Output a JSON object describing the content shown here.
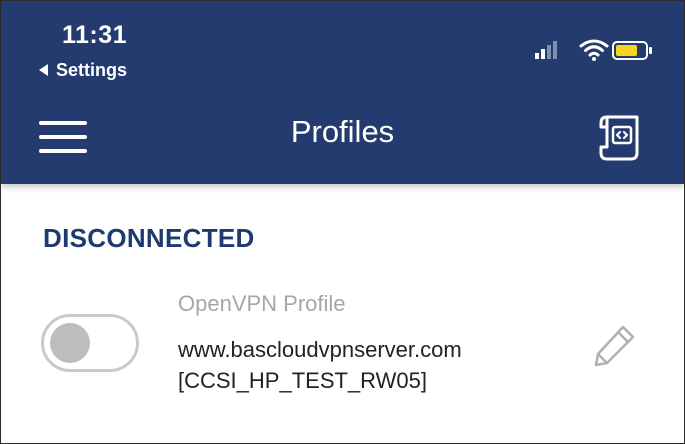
{
  "status_bar": {
    "time": "11:31",
    "back_label": "Settings",
    "battery_color": "#f7d51d"
  },
  "nav": {
    "title": "Profiles",
    "menu_icon": "hamburger-menu-icon",
    "import_icon": "import-profile-icon"
  },
  "colors": {
    "header_bg": "#233b6e",
    "section_title": "#1f3a6e"
  },
  "section": {
    "status": "DISCONNECTED"
  },
  "profile": {
    "type": "OpenVPN Profile",
    "server": "www.bascloudvpnserver.com",
    "tag": "[CCSI_HP_TEST_RW05]",
    "toggle_on": false,
    "edit_icon": "pencil-icon"
  }
}
